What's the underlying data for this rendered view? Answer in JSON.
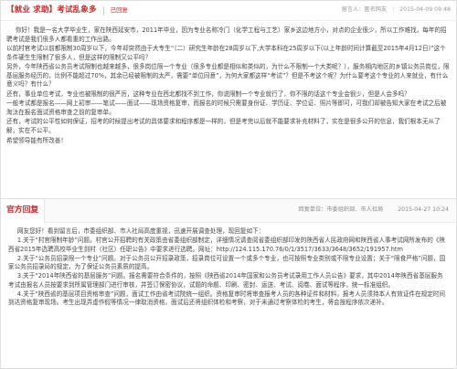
{
  "post": {
    "title": "【就业 求助】考试乱象多",
    "status": "已回复",
    "user_label": "留言人：匿名网友",
    "date": "2015-04-09 09:48",
    "paragraphs": [
      "你好！我是一名大学毕业生，家在陕西延安市，2011年毕业，因为专业名称冷门（化学工程与工艺）家乡这边地方小，对点的企业很少，所以工作难找，每年的招聘考试是我们很多人都看重的工作出路。",
      "以前村官考试以前都限制30周岁以下，今年却突然由于大专生“（二）研究生年龄在28周岁以下,大学本科在25周岁以下(以上年龄时间计算截至2015年4月12日)”这个条件硬生生限制了很多人，但是这样的限制又公平吗？",
      "另外，今年陕西省公务员考试限制也越来越多，很多岗位限一个专业（很多专业都是相似和类似的，为什么不限制一个大类呢？），服务期内地区的乡镇公务员岗位，限基层服务经历的，比例不能超过70%，其余已经被限制的太严，需要“单位同意”，为何大家都这样“考试”？但是不考这个呢？为什么要考这个专业的人来就业，有什么意义吗？有什么？",
      "还有，事业单位考试，专业也被限制的很严厉，这种专业在西北都找不到工作，你说限制一个专业就行了，你不限的话这个专业会很少，但是人会多吗？",
      "一般考试都是报名——网上初审——笔试——面试——现场资格复审，而报名的时候只需要身份证、学历证、学位证、照片等即可，可我们却被告知大家在考试之后被淘汰在报名面试资格审查之前的复审单。",
      "还有，考试的公平性如何保证，招考的时候提出考试的具体要求和程序都是一样的，但是考完以后就不能要求补充材料了，实在是很多公开的信息，我们根本无从了解，实在不公平。",
      "希望领导能有所改善！"
    ]
  },
  "reply": {
    "label": "官方回复",
    "from": "回复单位：市委组织部、市人社局",
    "date": "2015-04-27 10:24",
    "salutation": "网友您好！看到留言后，市委组织部、市人社局高度重视，迅速开展调查处理，现回复如下：",
    "items": [
      "1.关于“村官限制年龄”问题。村官公开招聘的有关政策由省委组织部制定，详细情况请查阅省委组织部印发的陕西省人民政府网和陕西省人事考试网所发布的《陕西省2015年选聘高校毕业生到村（社区）任职公告》中要求进行选聘。网址：http://124.115.170.76/0/1/3517/3633/3648/3652/191957.htm",
      "2.关于“公务员招录限一个专业”问题。对于公务员公开招录政策，招录岗位可设置一个或多个专业，也可按照专业类别或不限专业设置；关于“限食严格”问题，国家公务员招录局的规定，为了保证公务员素质的提高。",
      "3.关于“2014年陕西省的基层服务”问题。报名需要符合条件的，按照《陕西省2014年国家和公务员考试录用工作人员公告》要求，其中2014年陕西省基层服务考试由报名人员按要求到所属管理部门进行审核，并签订保密协议，试题的命题、印刷、密封、运送、考试、阅卷、面试等程序，统一标准组织。",
      "4.关于“陕西省的基层项目资格审查”问题，面试工作由省考试院统一组织。资格复审时将审查报考人员的各种证件和材料，报考人员须持本人有效证件在规定时间到达资格复审现场。考生出现弄虚作假等情况一律取消资格，面试后还将组织体检和考察，对于未通过考察体检的考生，将会按程序依次递补。"
    ]
  }
}
